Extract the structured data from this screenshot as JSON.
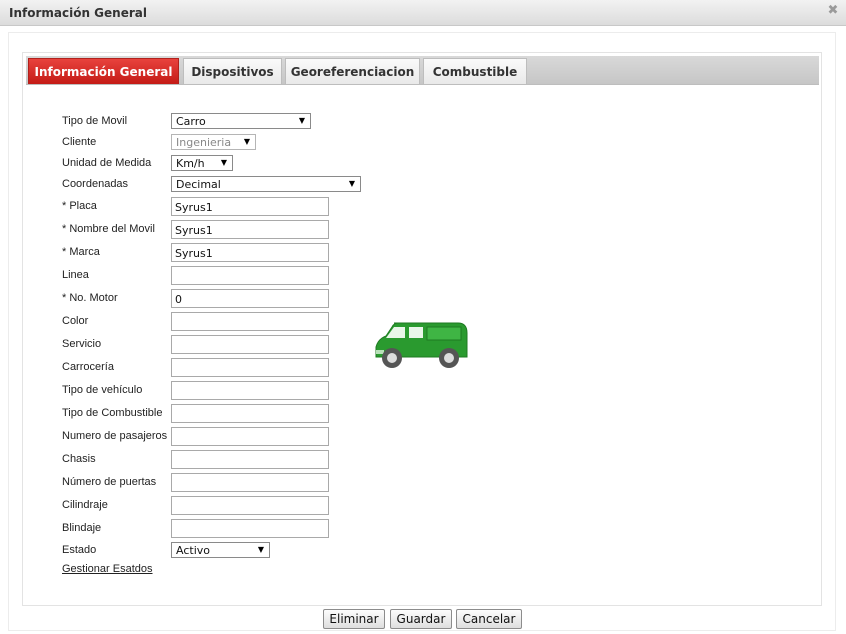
{
  "window": {
    "title": "Información General",
    "close_symbol": "✖"
  },
  "tabs": [
    {
      "label": "Información General",
      "active": true
    },
    {
      "label": "Dispositivos",
      "active": false
    },
    {
      "label": "Georeferenciacion",
      "active": false
    },
    {
      "label": "Combustible",
      "active": false
    }
  ],
  "form": {
    "tipo_movil": {
      "label": "Tipo de Movil",
      "value": "Carro"
    },
    "cliente": {
      "label": "Cliente",
      "value": "Ingenieria",
      "disabled": true
    },
    "unidad_medida": {
      "label": "Unidad de Medida",
      "value": "Km/h"
    },
    "coordenadas": {
      "label": "Coordenadas",
      "value": "Decimal"
    },
    "placa": {
      "label": "* Placa",
      "value": "Syrus1"
    },
    "nombre_movil": {
      "label": "* Nombre del Movil",
      "value": "Syrus1"
    },
    "marca": {
      "label": "* Marca",
      "value": "Syrus1"
    },
    "linea": {
      "label": "Linea",
      "value": ""
    },
    "no_motor": {
      "label": "* No. Motor",
      "value": "0"
    },
    "color": {
      "label": "Color",
      "value": ""
    },
    "servicio": {
      "label": "Servicio",
      "value": ""
    },
    "carroceria": {
      "label": "Carrocería",
      "value": ""
    },
    "tipo_vehiculo": {
      "label": "Tipo de vehículo",
      "value": ""
    },
    "tipo_combustible": {
      "label": "Tipo de Combustible",
      "value": ""
    },
    "numero_pasajeros": {
      "label": "Numero de pasajeros",
      "value": ""
    },
    "chasis": {
      "label": "Chasis",
      "value": ""
    },
    "numero_puertas": {
      "label": "Número de puertas",
      "value": ""
    },
    "cilindraje": {
      "label": "Cilindraje",
      "value": ""
    },
    "blindaje": {
      "label": "Blindaje",
      "value": ""
    },
    "estado": {
      "label": "Estado",
      "value": "Activo"
    },
    "gestionar_link": "Gestionar Esatdos"
  },
  "icons": {
    "vehicle": "green-van-icon",
    "dropdown": "dropdown-arrow-icon"
  },
  "colors": {
    "active_tab": "#d42520",
    "van": "#2a9a2f",
    "title_bar": "#e6e6e6"
  },
  "buttons": {
    "eliminar": "Eliminar",
    "guardar": "Guardar",
    "cancelar": "Cancelar"
  }
}
